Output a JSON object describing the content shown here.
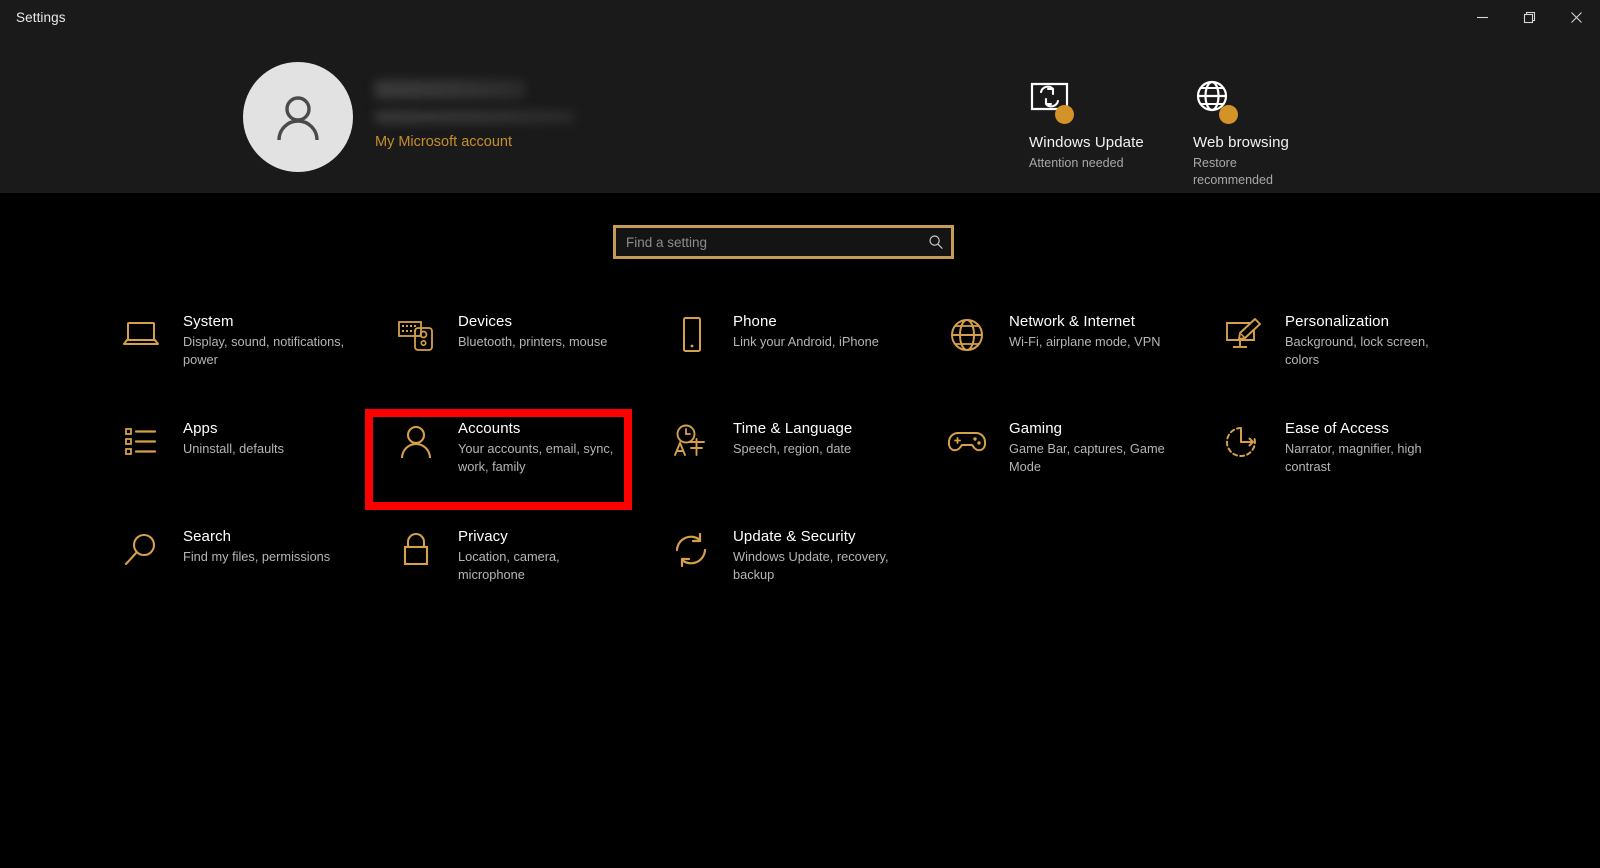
{
  "window": {
    "title": "Settings",
    "controls": [
      {
        "name": "minimize",
        "label": "Minimize"
      },
      {
        "name": "maximize",
        "label": "Restore"
      },
      {
        "name": "close",
        "label": "Close"
      }
    ]
  },
  "account": {
    "name_redacted": true,
    "email_redacted": true,
    "link_label": "My Microsoft account"
  },
  "header_status": [
    {
      "icon": "windows-update-icon",
      "title": "Windows Update",
      "subtitle": "Attention needed",
      "badge_color": "#d39326"
    },
    {
      "icon": "globe-icon",
      "title": "Web browsing",
      "subtitle": "Restore recommended",
      "badge_color": "#d39326"
    }
  ],
  "search": {
    "placeholder": "Find a setting",
    "value": "",
    "icon": "search-icon",
    "border_color": "#c69b55"
  },
  "tiles": [
    {
      "icon": "laptop-icon",
      "title": "System",
      "subtitle": "Display, sound, notifications, power"
    },
    {
      "icon": "keyboard-mouse-icon",
      "title": "Devices",
      "subtitle": "Bluetooth, printers, mouse"
    },
    {
      "icon": "phone-icon",
      "title": "Phone",
      "subtitle": "Link your Android, iPhone"
    },
    {
      "icon": "globe-icon",
      "title": "Network & Internet",
      "subtitle": "Wi-Fi, airplane mode, VPN"
    },
    {
      "icon": "brush-monitor-icon",
      "title": "Personalization",
      "subtitle": "Background, lock screen, colors"
    },
    {
      "icon": "list-icon",
      "title": "Apps",
      "subtitle": "Uninstall, defaults"
    },
    {
      "icon": "person-icon",
      "title": "Accounts",
      "subtitle": "Your accounts, email, sync, work, family"
    },
    {
      "icon": "clock-language-icon",
      "title": "Time & Language",
      "subtitle": "Speech, region, date"
    },
    {
      "icon": "gamepad-icon",
      "title": "Gaming",
      "subtitle": "Game Bar, captures, Game Mode"
    },
    {
      "icon": "clock-arrow-icon",
      "title": "Ease of Access",
      "subtitle": "Narrator, magnifier, high contrast"
    },
    {
      "icon": "magnifier-icon",
      "title": "Search",
      "subtitle": "Find my files, permissions"
    },
    {
      "icon": "lock-icon",
      "title": "Privacy",
      "subtitle": "Location, camera, microphone"
    },
    {
      "icon": "refresh-icon",
      "title": "Update & Security",
      "subtitle": "Windows Update, recovery, backup"
    }
  ],
  "highlight": {
    "target": "Accounts",
    "color": "#fe0000"
  },
  "colors": {
    "accent_gold": "#d6a04a",
    "background": "#000000",
    "header_background": "#1a1a1a",
    "link": "#c58e2e"
  }
}
